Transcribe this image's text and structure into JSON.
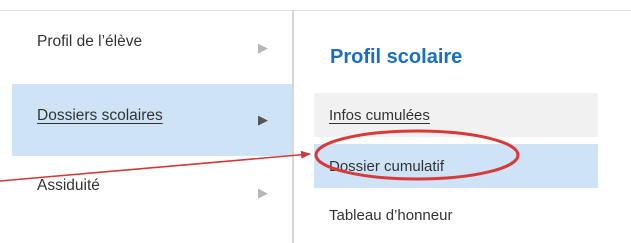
{
  "left_menu": {
    "items": [
      {
        "label": "Profil de l’élève"
      },
      {
        "label": "Dossiers scolaires"
      },
      {
        "label": "Assiduité"
      }
    ],
    "chevron_glyph": "▶"
  },
  "submenu": {
    "title": "Profil scolaire",
    "items": [
      {
        "label": "Infos cumulées"
      },
      {
        "label": "Dossier cumulatif"
      },
      {
        "label": "Tableau d’honneur"
      }
    ]
  },
  "annotation": {
    "color": "#d03a3a",
    "icons": [
      "arrow-icon",
      "circle-highlight-icon"
    ]
  }
}
